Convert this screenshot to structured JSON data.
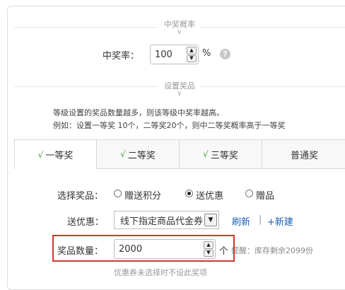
{
  "prob_section": {
    "title": "中奖概率",
    "chevron": "∨"
  },
  "win_rate": {
    "label": "中奖率：",
    "value": "100",
    "unit": "%",
    "help_icon": "?"
  },
  "prize_section": {
    "title": "设置奖品",
    "chevron": "∨"
  },
  "tips": {
    "line1": "等级设置的奖品数量越多，则该等级中奖率越高。",
    "line2": "例如：设置一等奖 10个，二等奖20个，则中二等奖概率高于一等奖"
  },
  "tabs": [
    {
      "check": "√",
      "label": "一等奖",
      "active": true
    },
    {
      "check": "√",
      "label": "二等奖",
      "active": false
    },
    {
      "check": "√",
      "label": "三等奖",
      "active": false
    },
    {
      "check": "",
      "label": "普通奖",
      "active": false
    }
  ],
  "prize_select": {
    "label": "选择奖品：",
    "options": [
      "赠送积分",
      "送优惠",
      "赠品"
    ],
    "selected": "送优惠"
  },
  "coupon": {
    "label": "送优惠：",
    "selected": "线下指定商品代金券",
    "refresh": "刷新",
    "separator": "|",
    "new": "+新建"
  },
  "quantity": {
    "label": "奖品数量：",
    "value": "2000",
    "unit": "个",
    "hint": "提醒：库存剩余2099份"
  },
  "footer_note": "优惠券未选择时不设此奖项",
  "colors": {
    "highlight": "#d9342b",
    "link": "#1a5fb4",
    "check": "#3aa33a"
  }
}
